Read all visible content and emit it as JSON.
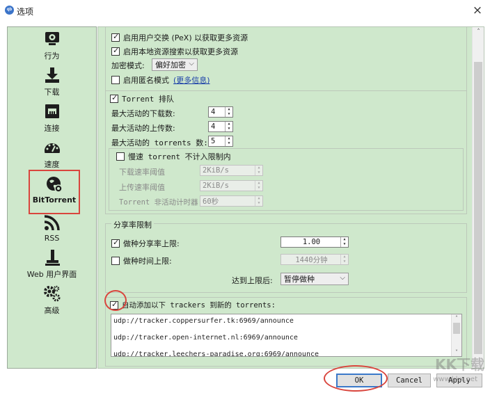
{
  "window": {
    "title": "选项",
    "app_icon_text": "qb",
    "close_glyph": "×"
  },
  "sidebar": {
    "items": [
      {
        "label": "行为",
        "icon": "behavior-icon"
      },
      {
        "label": "下载",
        "icon": "download-icon"
      },
      {
        "label": "连接",
        "icon": "connection-icon"
      },
      {
        "label": "速度",
        "icon": "speed-icon"
      },
      {
        "label": "BitTorrent",
        "icon": "bittorrent-icon",
        "selected": true
      },
      {
        "label": "RSS",
        "icon": "rss-icon"
      },
      {
        "label": "Web 用户界面",
        "icon": "web-ui-icon"
      },
      {
        "label": "高级",
        "icon": "advanced-icon"
      }
    ]
  },
  "privacy": {
    "pex_label": "启用用户交换 (PeX) 以获取更多资源",
    "lsd_label": "启用本地资源搜索以获取更多资源",
    "encryption_label": "加密模式:",
    "encryption_value": "偏好加密",
    "anon_label": "启用匿名模式",
    "anon_link": "(更多信息)"
  },
  "queue": {
    "group_label": "Torrent 排队",
    "max_downloads_label": "最大活动的下载数:",
    "max_downloads_value": "4",
    "max_uploads_label": "最大活动的上传数:",
    "max_uploads_value": "4",
    "max_torrents_label": "最大活动的 torrents 数:",
    "max_torrents_value": "5",
    "slow_label": "慢速 torrent 不计入限制内",
    "dl_threshold_label": "下载速率阈值",
    "dl_threshold_value": "2KiB/s",
    "ul_threshold_label": "上传速率阈值",
    "ul_threshold_value": "2KiB/s",
    "inactive_timer_label": "Torrent 非活动计时器",
    "inactive_timer_value": "60秒"
  },
  "share_limit": {
    "group_label": "分享率限制",
    "ratio_label": "做种分享率上限:",
    "ratio_value": "1.00",
    "time_label": "做种时间上限:",
    "time_value": "1440分钟",
    "action_label": "达到上限后:",
    "action_value": "暂停做种"
  },
  "trackers": {
    "label": "自动添加以下 trackers 到新的 torrents:",
    "list": [
      "udp://tracker.coppersurfer.tk:6969/announce",
      "udp://tracker.open-internet.nl:6969/announce",
      "udp://tracker.leechers-paradise.org:6969/announce"
    ]
  },
  "buttons": {
    "ok": "OK",
    "cancel": "Cancel",
    "apply": "Apply"
  },
  "watermark": {
    "text": "KK下载",
    "url": "www.kkx.net"
  },
  "colors": {
    "panel_bg": "#cfe8cc",
    "highlight": "#d9453d",
    "icon_dark": "#1d1d1d"
  }
}
